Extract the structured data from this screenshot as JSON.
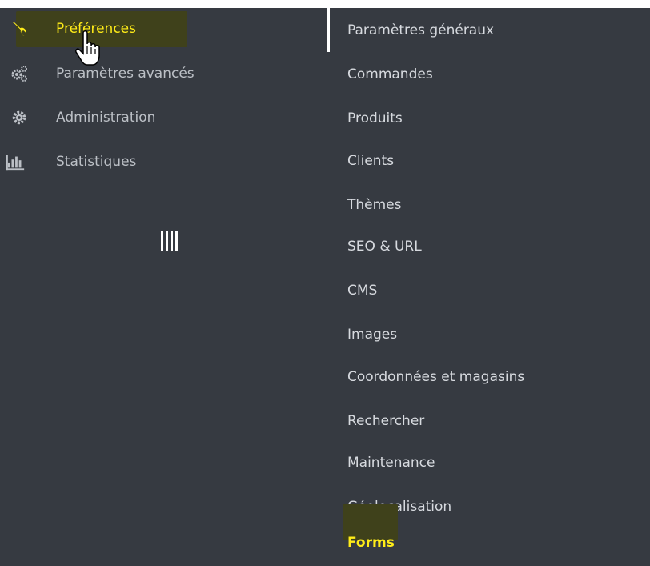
{
  "sidebar": {
    "items": [
      {
        "label": "Préférences",
        "icon": "wrench-icon",
        "active": true
      },
      {
        "label": "Paramètres avancés",
        "icon": "gears-icon",
        "active": false
      },
      {
        "label": "Administration",
        "icon": "gear-icon",
        "active": false
      },
      {
        "label": "Statistiques",
        "icon": "bar-chart-icon",
        "active": false
      }
    ],
    "collapse_icon": "vertical-bars-icon"
  },
  "submenu": {
    "items": [
      {
        "label": "Paramètres généraux"
      },
      {
        "label": "Commandes"
      },
      {
        "label": "Produits"
      },
      {
        "label": "Clients"
      },
      {
        "label": "Thèmes"
      },
      {
        "label": "SEO & URL"
      },
      {
        "label": "CMS"
      },
      {
        "label": "Images"
      },
      {
        "label": "Coordonnées et magasins"
      },
      {
        "label": "Rechercher"
      },
      {
        "label": "Maintenance"
      },
      {
        "label": "Géolocalisation"
      },
      {
        "label": "Forms",
        "highlighted": true
      }
    ]
  },
  "colors": {
    "background": "#363a41",
    "accent": "#ffec18",
    "text": "#bcc0c6",
    "highlight": "#3f411b"
  }
}
